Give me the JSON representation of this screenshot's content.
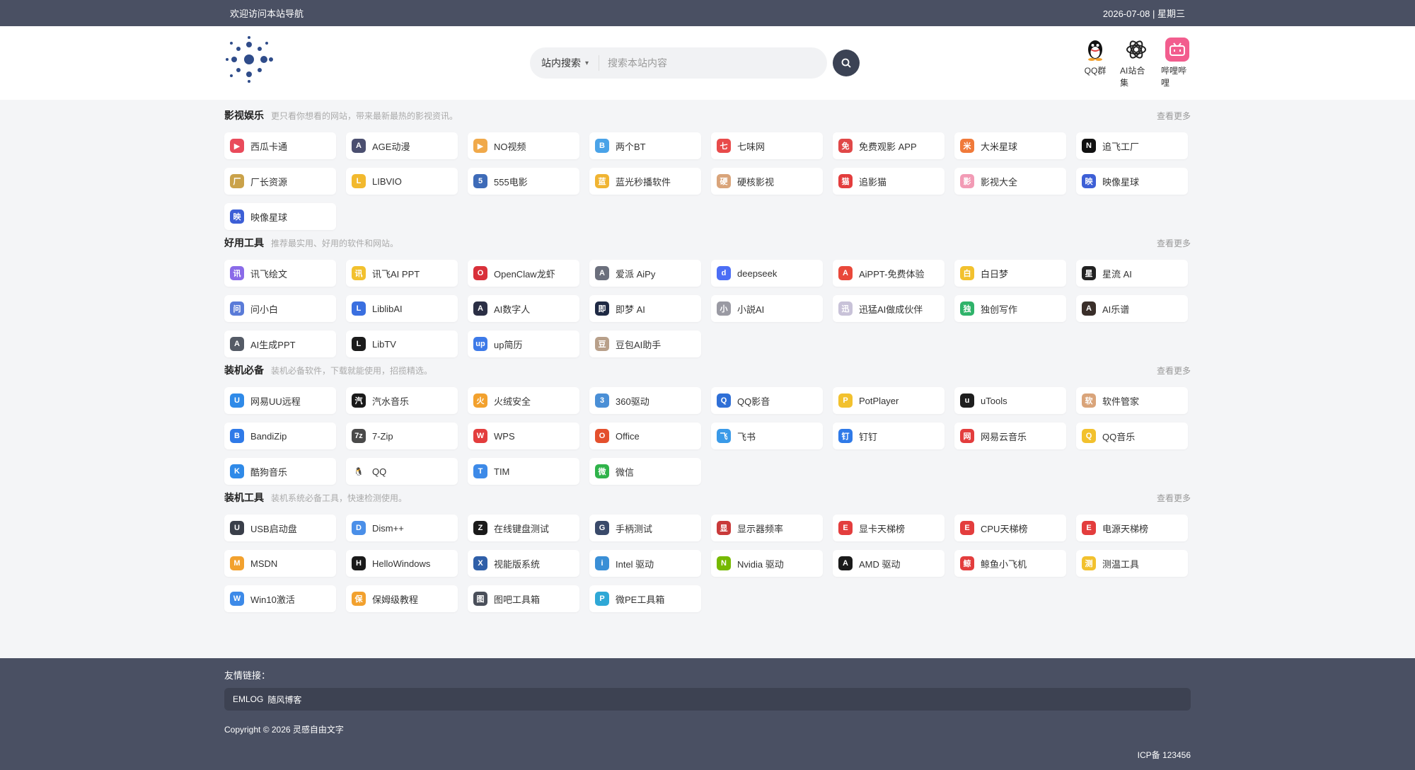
{
  "topbar": {
    "welcome": "欢迎访问本站导航",
    "date": "2026-07-08 | 星期三"
  },
  "search": {
    "scope": "站内搜索",
    "placeholder": "搜索本站内容"
  },
  "quick_links": [
    {
      "label": "QQ群",
      "icon": "penguin-icon",
      "color": "#ffffff"
    },
    {
      "label": "AI站合集",
      "icon": "openai-icon",
      "color": "#ffffff"
    },
    {
      "label": "哔哩哔哩",
      "icon": "bilibili-icon",
      "color": "#f25d8e"
    }
  ],
  "sections": [
    {
      "title": "影视娱乐",
      "desc": "更只看你想看的网站，带来最新最热的影视资讯。",
      "more": "查看更多",
      "items": [
        {
          "label": "西瓜卡通",
          "color": "#e94b5b",
          "glyph": "▶"
        },
        {
          "label": "AGE动漫",
          "color": "#4b4f70",
          "glyph": "A"
        },
        {
          "label": "NO视频",
          "color": "#f0a94a",
          "glyph": "▶"
        },
        {
          "label": "两个BT",
          "color": "#4aa3e8",
          "glyph": "B"
        },
        {
          "label": "七味网",
          "color": "#e84b4b",
          "glyph": "七"
        },
        {
          "label": "免费观影 APP",
          "color": "#e04848",
          "glyph": "免"
        },
        {
          "label": "大米星球",
          "color": "#f07a3a",
          "glyph": "米"
        },
        {
          "label": "追飞工厂",
          "color": "#111111",
          "glyph": "N"
        },
        {
          "label": "厂长资源",
          "color": "#caa24a",
          "glyph": "厂"
        },
        {
          "label": "LIBVIO",
          "color": "#f2b92e",
          "glyph": "L"
        },
        {
          "label": "555电影",
          "color": "#3e6bb8",
          "glyph": "5"
        },
        {
          "label": "蓝光秒播软件",
          "color": "#f0b432",
          "glyph": "蓝"
        },
        {
          "label": "硬核影视",
          "color": "#d9a47a",
          "glyph": "硬"
        },
        {
          "label": "追影猫",
          "color": "#e33d3d",
          "glyph": "猫"
        },
        {
          "label": "影视大全",
          "color": "#f29bb5",
          "glyph": "影"
        },
        {
          "label": "映像星球",
          "color": "#3d5fd6",
          "glyph": "映"
        },
        {
          "label": "映像星球",
          "color": "#3d5fd6",
          "glyph": "映"
        }
      ]
    },
    {
      "title": "好用工具",
      "desc": "推荐最实用、好用的软件和网站。",
      "more": "查看更多",
      "items": [
        {
          "label": "讯飞绘文",
          "color": "#8a6be8",
          "glyph": "讯"
        },
        {
          "label": "讯飞AI PPT",
          "color": "#f2c12e",
          "glyph": "讯"
        },
        {
          "label": "OpenClaw龙虾",
          "color": "#d9303a",
          "glyph": "O"
        },
        {
          "label": "爱派 AiPy",
          "color": "#6b6f7c",
          "glyph": "A"
        },
        {
          "label": "deepseek",
          "color": "#4c6ef5",
          "glyph": "d"
        },
        {
          "label": "AiPPT-免费体验",
          "color": "#e9483a",
          "glyph": "A"
        },
        {
          "label": "白日梦",
          "color": "#f2c12e",
          "glyph": "白"
        },
        {
          "label": "星流 AI",
          "color": "#222222",
          "glyph": "星"
        },
        {
          "label": "问小白",
          "color": "#5a7bd8",
          "glyph": "问"
        },
        {
          "label": "LiblibAI",
          "color": "#3a6fe0",
          "glyph": "L"
        },
        {
          "label": "AI数字人",
          "color": "#2b2f45",
          "glyph": "A"
        },
        {
          "label": "即梦 AI",
          "color": "#1f2a44",
          "glyph": "即"
        },
        {
          "label": "小説AI",
          "color": "#9a9aa3",
          "glyph": "小"
        },
        {
          "label": "迅猛AI做成伙伴",
          "color": "#c8c2d8",
          "glyph": "迅"
        },
        {
          "label": "独创写作",
          "color": "#2fb36a",
          "glyph": "独"
        },
        {
          "label": "AI乐谱",
          "color": "#3a2f2a",
          "glyph": "A"
        },
        {
          "label": "AI生成PPT",
          "color": "#555b66",
          "glyph": "A"
        },
        {
          "label": "LibTV",
          "color": "#1b1b1b",
          "glyph": "L"
        },
        {
          "label": "up简历",
          "color": "#3d7ae8",
          "glyph": "up"
        },
        {
          "label": "豆包AI助手",
          "color": "#b8a08a",
          "glyph": "豆"
        }
      ]
    },
    {
      "title": "装机必备",
      "desc": "装机必备软件，下载就能使用，招揽精选。",
      "more": "查看更多",
      "items": [
        {
          "label": "网易UU远程",
          "color": "#2f8ae8",
          "glyph": "U"
        },
        {
          "label": "汽水音乐",
          "color": "#1a1a1a",
          "glyph": "汽"
        },
        {
          "label": "火绒安全",
          "color": "#f2a12e",
          "glyph": "火"
        },
        {
          "label": "360驱动",
          "color": "#4a8fd6",
          "glyph": "3"
        },
        {
          "label": "QQ影音",
          "color": "#2f6fd6",
          "glyph": "Q"
        },
        {
          "label": "PotPlayer",
          "color": "#f2c12e",
          "glyph": "P"
        },
        {
          "label": "uTools",
          "color": "#1e1e1e",
          "glyph": "u"
        },
        {
          "label": "软件管家",
          "color": "#d9a47a",
          "glyph": "软"
        },
        {
          "label": "BandiZip",
          "color": "#2f7ae8",
          "glyph": "B"
        },
        {
          "label": "7-Zip",
          "color": "#4a4a4a",
          "glyph": "7z"
        },
        {
          "label": "WPS",
          "color": "#e33d3d",
          "glyph": "W"
        },
        {
          "label": "Office",
          "color": "#e4502d",
          "glyph": "O"
        },
        {
          "label": "飞书",
          "color": "#3a9ae8",
          "glyph": "飞"
        },
        {
          "label": "钉钉",
          "color": "#2f7ae8",
          "glyph": "钉"
        },
        {
          "label": "网易云音乐",
          "color": "#e33d3d",
          "glyph": "网"
        },
        {
          "label": "QQ音乐",
          "color": "#f2c12e",
          "glyph": "Q"
        },
        {
          "label": "酷狗音乐",
          "color": "#2f8ae8",
          "glyph": "K"
        },
        {
          "label": "QQ",
          "color": "#ffffff",
          "glyph": "🐧"
        },
        {
          "label": "TIM",
          "color": "#3d8ae8",
          "glyph": "T"
        },
        {
          "label": "微信",
          "color": "#2fb34a",
          "glyph": "微"
        }
      ]
    },
    {
      "title": "装机工具",
      "desc": "装机系统必备工具，快速检测使用。",
      "more": "查看更多",
      "items": [
        {
          "label": "USB启动盘",
          "color": "#3a3f4a",
          "glyph": "U"
        },
        {
          "label": "Dism++",
          "color": "#4a8fe8",
          "glyph": "D"
        },
        {
          "label": "在线键盘测试",
          "color": "#1a1a1a",
          "glyph": "Z"
        },
        {
          "label": "手柄测试",
          "color": "#3a4a6a",
          "glyph": "G"
        },
        {
          "label": "显示器频率",
          "color": "#c93a3a",
          "glyph": "显"
        },
        {
          "label": "显卡天梯榜",
          "color": "#e33d3d",
          "glyph": "E"
        },
        {
          "label": "CPU天梯榜",
          "color": "#e33d3d",
          "glyph": "E"
        },
        {
          "label": "电源天梯榜",
          "color": "#e33d3d",
          "glyph": "E"
        },
        {
          "label": "MSDN",
          "color": "#f2a12e",
          "glyph": "M"
        },
        {
          "label": "HelloWindows",
          "color": "#1a1a1a",
          "glyph": "H"
        },
        {
          "label": "视能版系统",
          "color": "#2f5fa8",
          "glyph": "X"
        },
        {
          "label": "Intel 驱动",
          "color": "#3a8fd6",
          "glyph": "i"
        },
        {
          "label": "Nvidia 驱动",
          "color": "#76b900",
          "glyph": "N"
        },
        {
          "label": "AMD 驱动",
          "color": "#1a1a1a",
          "glyph": "A"
        },
        {
          "label": "鲸鱼小飞机",
          "color": "#e33d3d",
          "glyph": "鲸"
        },
        {
          "label": "测温工具",
          "color": "#f2c12e",
          "glyph": "测"
        },
        {
          "label": "Win10激活",
          "color": "#3d8ae8",
          "glyph": "W"
        },
        {
          "label": "保姆级教程",
          "color": "#f2a12e",
          "glyph": "保"
        },
        {
          "label": "图吧工具箱",
          "color": "#4a4f5a",
          "glyph": "图"
        },
        {
          "label": "微PE工具箱",
          "color": "#2fa8d6",
          "glyph": "P"
        }
      ]
    }
  ],
  "footer": {
    "friend_label": "友情链接：",
    "links": [
      "EMLOG",
      "随风博客"
    ],
    "copyright": "Copyright © 2026 灵感自由文字",
    "icp": "ICP备 123456"
  }
}
